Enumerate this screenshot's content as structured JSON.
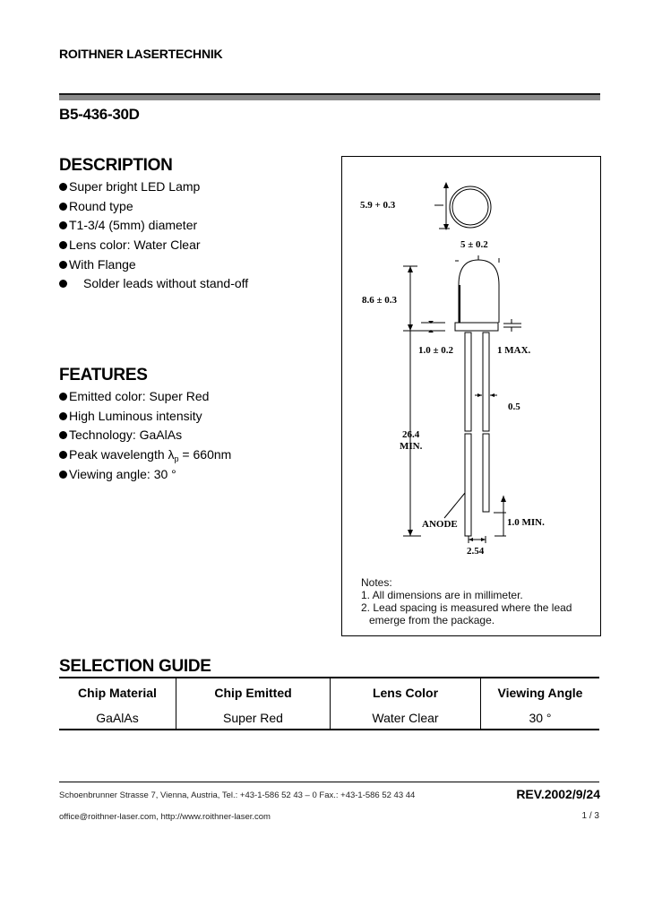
{
  "header": {
    "company": "ROITHNER LASERTECHNIK",
    "part_number": "B5-436-30D"
  },
  "description": {
    "title": "DESCRIPTION",
    "items": [
      "Super bright LED Lamp",
      "Round type",
      "T1-3/4 (5mm) diameter",
      "Lens color: Water Clear",
      "With Flange",
      "Solder leads without stand-off"
    ]
  },
  "features": {
    "title": "FEATURES",
    "items": [
      "Emitted color: Super Red",
      "High Luminous intensity",
      "Technology: GaAlAs",
      "Viewing angle: 30 °"
    ],
    "peak": {
      "prefix": "Peak wavelength λ",
      "subscript": "p",
      "suffix": " = 660nm"
    }
  },
  "drawing": {
    "dimensions": {
      "flange_diameter": "5.9 + 0.3",
      "body_diameter": "5 ± 0.2",
      "body_height": "8.6 ± 0.3",
      "flange_thickness": "1.0 ± 0.2",
      "meniscus": "1 MAX.",
      "lead_width": "0.5",
      "lead_length_value": "26.4",
      "lead_length_qualifier": "MIN.",
      "lead_offset": "1.0 MIN.",
      "lead_spacing": "2.54",
      "anode_label": "ANODE"
    },
    "notes": {
      "title": "Notes:",
      "items": [
        "1. All dimensions are in millimeter.",
        "2. Lead spacing is measured where the lead",
        "   emerge from the package."
      ]
    }
  },
  "selection_guide": {
    "title": "SELECTION GUIDE",
    "columns": [
      "Chip Material",
      "Chip Emitted",
      "Lens Color",
      "Viewing Angle"
    ],
    "rows": [
      [
        "GaAlAs",
        "Super Red",
        "Water Clear",
        "30 °"
      ]
    ]
  },
  "footer": {
    "address": "Schoenbrunner Strasse 7, Vienna, Austria,  Tel.: +43-1-586 52 43 – 0  Fax.: +43-1-586 52 43 44",
    "contact": "office@roithner-laser.com, http://www.roithner-laser.com",
    "revision": "REV.2002/9/24",
    "page": "1 / 3"
  }
}
